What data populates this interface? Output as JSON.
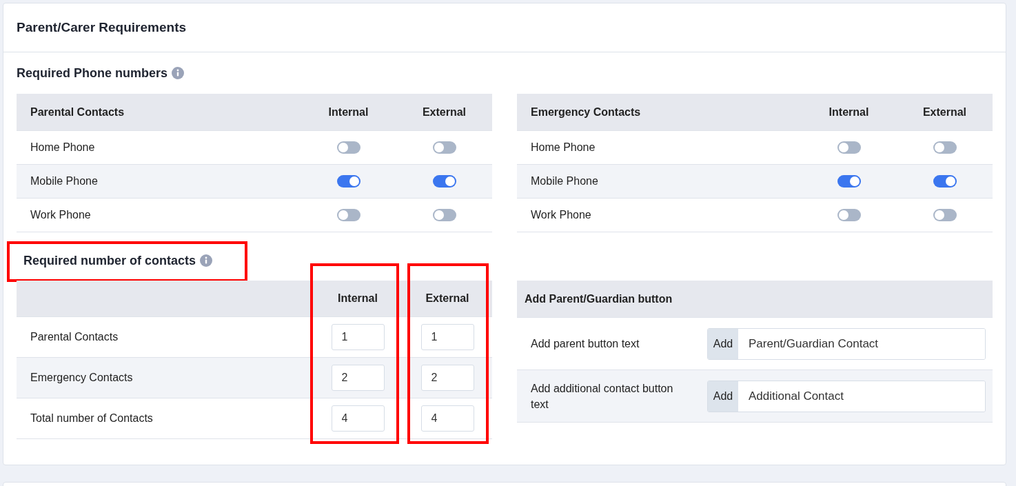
{
  "card": {
    "title": "Parent/Carer Requirements"
  },
  "phone_section": {
    "title": "Required Phone numbers",
    "tables": [
      {
        "columns": [
          "Parental Contacts",
          "Internal",
          "External"
        ],
        "rows": [
          {
            "label": "Home Phone",
            "internal": {
              "on": false
            },
            "external": {
              "on": false
            }
          },
          {
            "label": "Mobile Phone",
            "internal": {
              "on": true
            },
            "external": {
              "on": true
            }
          },
          {
            "label": "Work Phone",
            "internal": {
              "on": false
            },
            "external": {
              "on": false
            }
          }
        ]
      },
      {
        "columns": [
          "Emergency Contacts",
          "Internal",
          "External"
        ],
        "rows": [
          {
            "label": "Home Phone",
            "internal": {
              "on": false
            },
            "external": {
              "on": false
            }
          },
          {
            "label": "Mobile Phone",
            "internal": {
              "on": true
            },
            "external": {
              "on": true
            }
          },
          {
            "label": "Work Phone",
            "internal": {
              "on": false
            },
            "external": {
              "on": false
            }
          }
        ]
      }
    ]
  },
  "contacts_section": {
    "title": "Required number of contacts",
    "highlighted": true,
    "columns": [
      {
        "label": "Internal",
        "highlighted": true
      },
      {
        "label": "External",
        "highlighted": true
      }
    ],
    "rows": [
      {
        "label": "Parental Contacts",
        "values": [
          "1",
          "1"
        ]
      },
      {
        "label": "Emergency Contacts",
        "values": [
          "2",
          "2"
        ]
      },
      {
        "label": "Total number of Contacts",
        "values": [
          "4",
          "4"
        ]
      }
    ]
  },
  "button_section": {
    "title": "Add Parent/Guardian button",
    "rows": [
      {
        "label": "Add parent button text",
        "addon": "Add",
        "value": "Parent/Guardian Contact"
      },
      {
        "label": "Add additional contact button text",
        "addon": "Add",
        "value": "Additional Contact"
      }
    ]
  }
}
